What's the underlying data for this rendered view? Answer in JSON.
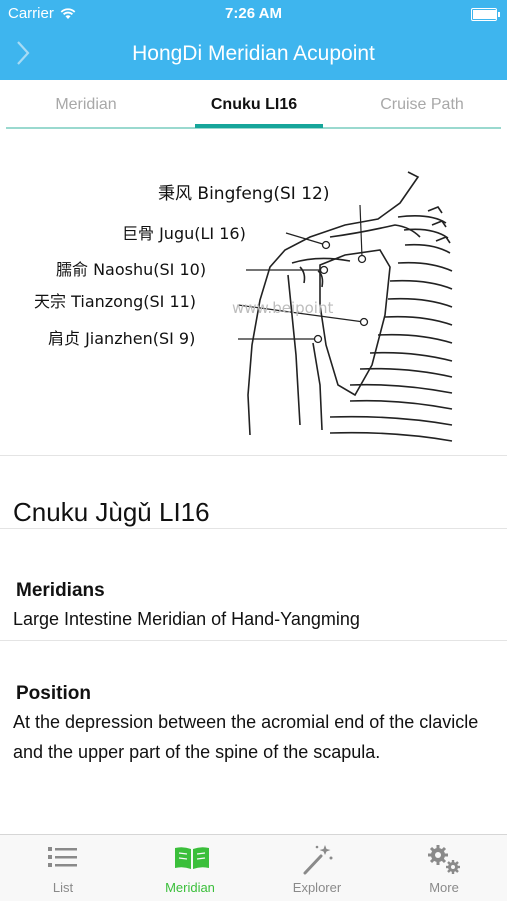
{
  "status": {
    "carrier": "Carrier",
    "time": "7:26 AM",
    "battery_level": 1.0
  },
  "nav": {
    "title": "HongDi Meridian Acupoint"
  },
  "tabs": [
    {
      "label": "Meridian",
      "active": false
    },
    {
      "label": "Cnuku LI16",
      "active": true
    },
    {
      "label": "Cruise Path",
      "active": false
    }
  ],
  "illustration": {
    "labels": [
      "秉风 Bingfeng(SI 12)",
      "巨骨 Jugu(LI 16)",
      "臑俞 Naoshu(SI 10)",
      "天宗 Tianzong(SI 11)",
      "肩贞 Jianzhen(SI 9)"
    ],
    "watermark": "www.beipoint"
  },
  "acupoint": {
    "title": "Cnuku Jùgǔ LI16",
    "meridians_heading": "Meridians",
    "meridians_text": "Large Intestine Meridian of Hand-Yangming",
    "position_heading": "Position",
    "position_text": "At the depression between the acromial end of the clavicle and the upper part of the spine of the scapula."
  },
  "tabbar": [
    {
      "label": "List",
      "icon": "list-icon",
      "active": false
    },
    {
      "label": "Meridian",
      "icon": "book-icon",
      "active": true
    },
    {
      "label": "Explorer",
      "icon": "magic-wand-icon",
      "active": false
    },
    {
      "label": "More",
      "icon": "gears-icon",
      "active": false
    }
  ],
  "colors": {
    "accent": "#3eb5ee",
    "tab_active": "#16a59a",
    "tabbar_active": "#3bbf3b"
  }
}
